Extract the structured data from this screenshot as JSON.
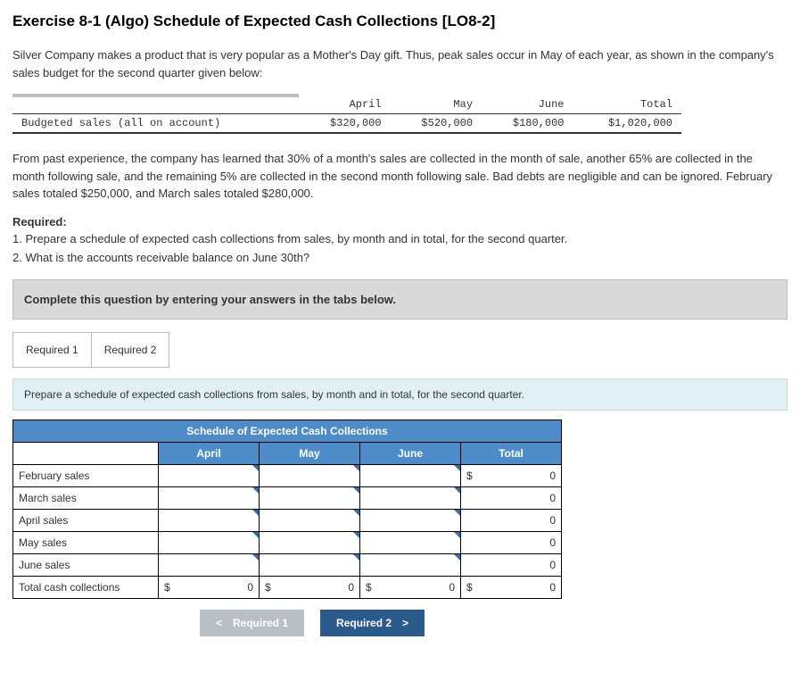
{
  "title": "Exercise 8-1 (Algo) Schedule of Expected Cash Collections [LO8-2]",
  "intro1": "Silver Company makes a product that is very popular as a Mother's Day gift. Thus, peak sales occur in May of each year, as shown in the company's sales budget for the second quarter given below:",
  "budget": {
    "row_label": "Budgeted sales (all on account)",
    "cols": [
      "April",
      "May",
      "June",
      "Total"
    ],
    "vals": [
      "$320,000",
      "$520,000",
      "$180,000",
      "$1,020,000"
    ]
  },
  "intro2": "From past experience, the company has learned that 30% of a month's sales are collected in the month of sale, another 65% are collected in the month following sale, and the remaining 5% are collected in the second month following sale. Bad debts are negligible and can be ignored. February sales totaled $250,000, and March sales totaled $280,000.",
  "required_label": "Required:",
  "req1": "1. Prepare a schedule of expected cash collections from sales, by month and in total, for the second quarter.",
  "req2": "2. What is the accounts receivable balance on June 30th?",
  "instr_bar": "Complete this question by entering your answers in the tabs below.",
  "tabs": {
    "t1": "Required 1",
    "t2": "Required 2"
  },
  "subinstr": "Prepare a schedule of expected cash collections from sales, by month and in total, for the second quarter.",
  "sched": {
    "title": "Schedule of Expected Cash Collections",
    "cols": [
      "April",
      "May",
      "June",
      "Total"
    ],
    "rows": [
      "February sales",
      "March sales",
      "April sales",
      "May sales",
      "June sales",
      "Total cash collections"
    ],
    "currency": "$",
    "totals": [
      "0",
      "0",
      "0",
      "0",
      "0",
      "0"
    ],
    "bottom": {
      "apr": "0",
      "may": "0",
      "jun": "0",
      "tot": "0"
    }
  },
  "nav": {
    "prev": "< Required 1",
    "next": "Required 2 >"
  }
}
